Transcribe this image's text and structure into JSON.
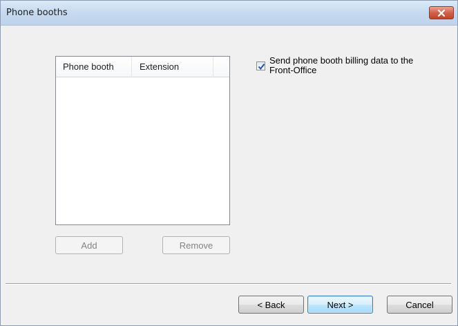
{
  "window": {
    "title": "Phone booths"
  },
  "title_bar_buttons": {
    "close_icon": "close-x-icon"
  },
  "phone_booth_list": {
    "columns": [
      "Phone booth",
      "Extension",
      ""
    ],
    "rows": []
  },
  "list_buttons": {
    "add_label": "Add",
    "remove_label": "Remove"
  },
  "billing_option": {
    "label": "Send phone booth billing data to the Front-Office",
    "checked": true
  },
  "wizard_buttons": {
    "back_label": "< Back",
    "next_label": "Next >",
    "cancel_label": "Cancel"
  },
  "colors": {
    "close_button": "#c2442c",
    "default_button_border": "#3c7fb1",
    "dialog_background": "#f0f0f0"
  }
}
